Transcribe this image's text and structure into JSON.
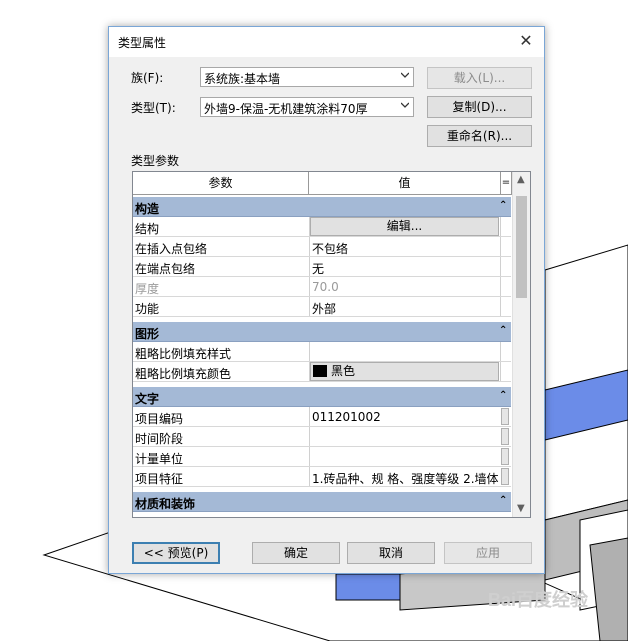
{
  "dialog": {
    "title": "类型属性",
    "close_glyph": "✕",
    "family_label": "族(F):",
    "family_value": "系统族:基本墙",
    "type_label": "类型(T):",
    "type_value": "外墙9-保温-无机建筑涂料70厚",
    "load_button": "载入(L)...",
    "duplicate_button": "复制(D)...",
    "rename_button": "重命名(R)...",
    "type_params_label": "类型参数"
  },
  "grid": {
    "col_param": "参数",
    "col_value": "值",
    "col_eq": "=",
    "collapse_glyph": "⌃",
    "groups": [
      {
        "name": "构造",
        "rows": [
          {
            "param": "结构",
            "value": "编辑...",
            "kind": "button"
          },
          {
            "param": "在插入点包络",
            "value": "不包络"
          },
          {
            "param": "在端点包络",
            "value": "无"
          },
          {
            "param": "厚度",
            "value": "70.0",
            "disabled": true
          },
          {
            "param": "功能",
            "value": "外部"
          }
        ]
      },
      {
        "name": "图形",
        "rows": [
          {
            "param": "粗略比例填充样式",
            "value": ""
          },
          {
            "param": "粗略比例填充颜色",
            "value": "黑色",
            "kind": "color",
            "color": "#000000"
          }
        ]
      },
      {
        "name": "文字",
        "rows": [
          {
            "param": "项目编码",
            "value": "011201002",
            "ellipsis": true
          },
          {
            "param": "时间阶段",
            "value": "",
            "ellipsis": true
          },
          {
            "param": "计量单位",
            "value": "",
            "ellipsis": true
          },
          {
            "param": "项目特征",
            "value": "1.砖品种、规 格、强度等级 2.墙体",
            "ellipsis": true
          }
        ]
      },
      {
        "name": "材质和装饰",
        "rows": []
      }
    ]
  },
  "footer": {
    "preview_button": "<< 预览(P)",
    "ok_button": "确定",
    "cancel_button": "取消",
    "apply_button": "应用"
  },
  "watermark": "Bai百度经验",
  "colors": {
    "group_header": "#a4b9d6",
    "wall_blue": "#6b8ce8",
    "dialog_border": "#7aa6d6"
  }
}
